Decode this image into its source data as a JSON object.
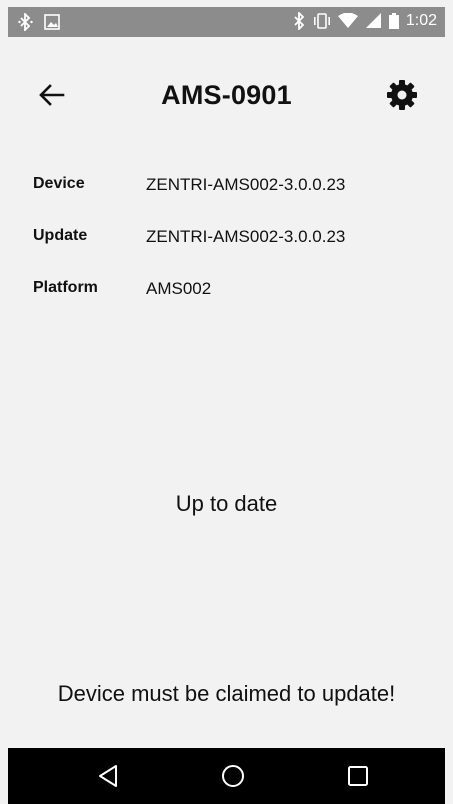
{
  "status_bar": {
    "time": "1:02",
    "icons": [
      "bluetooth-icon",
      "image-icon",
      "vibrate-icon",
      "wifi-icon",
      "signal-icon",
      "battery-icon"
    ]
  },
  "app_bar": {
    "title": "AMS-0901",
    "back_icon": "arrow-left-icon",
    "settings_icon": "gear-icon"
  },
  "device_info": {
    "rows": [
      {
        "label": "Device",
        "value": "ZENTRI-AMS002-3.0.0.23"
      },
      {
        "label": "Update",
        "value": "ZENTRI-AMS002-3.0.0.23"
      },
      {
        "label": "Platform",
        "value": "AMS002"
      }
    ]
  },
  "update_status": "Up to date",
  "claim_message": "Device must be claimed to update!",
  "nav_bar": {
    "buttons": [
      "back-triangle-icon",
      "home-circle-icon",
      "recents-square-icon"
    ]
  }
}
